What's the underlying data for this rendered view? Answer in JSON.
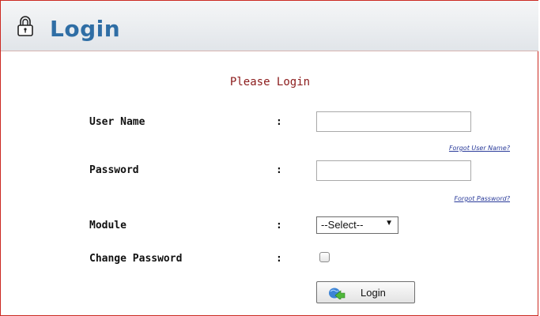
{
  "header": {
    "title": "Login",
    "icon": "lock-icon"
  },
  "form": {
    "heading": "Please Login",
    "colon": ":",
    "username": {
      "label": "User Name",
      "value": "",
      "forgot": "Forgot User Name?"
    },
    "password": {
      "label": "Password",
      "value": "",
      "forgot": "Forgot Password?"
    },
    "module": {
      "label": "Module",
      "selected": "--Select--"
    },
    "change_password": {
      "label": "Change Password",
      "checked": false
    },
    "login_button": {
      "label": "Login",
      "icon": "globe-arrow-icon"
    }
  },
  "colors": {
    "title": "#2f6ea5",
    "heading": "#8b1a1a",
    "link": "#2a3b9a",
    "border": "#cc2a22"
  }
}
